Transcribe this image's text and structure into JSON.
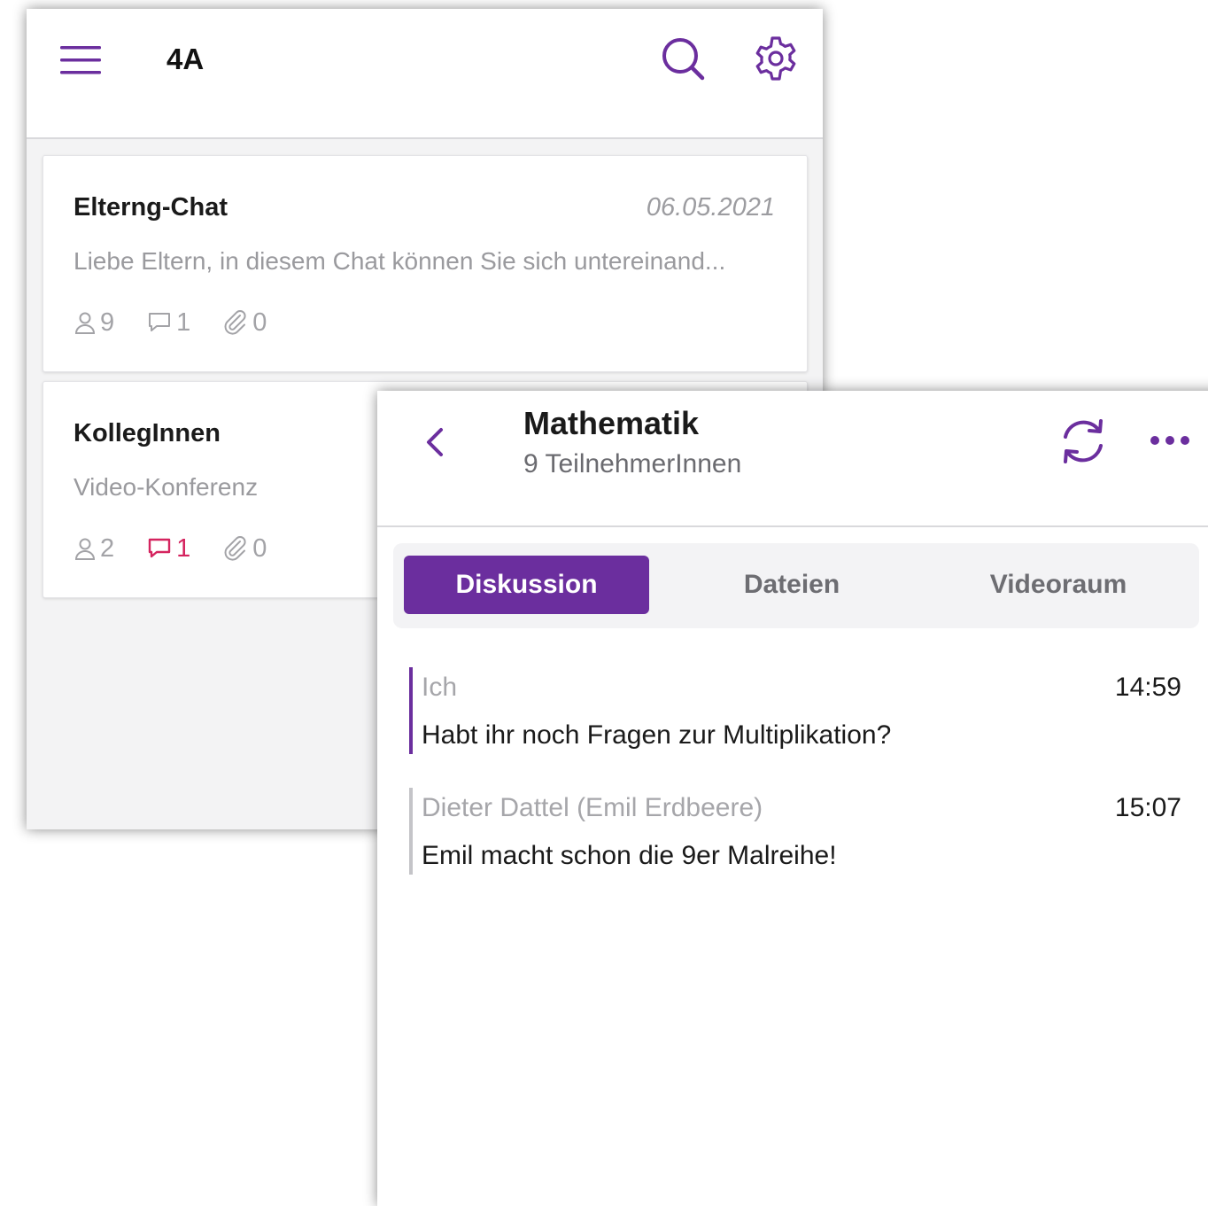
{
  "colors": {
    "accent": "#6b2e9e",
    "unread": "#d5245f",
    "muted": "#9a9a9e"
  },
  "group_list": {
    "header": {
      "title": "4A",
      "menu_icon": "hamburger-menu-icon",
      "search_icon": "search-icon",
      "settings_icon": "gear-icon"
    },
    "cards": [
      {
        "title": "Elterng-Chat",
        "date": "06.05.2021",
        "preview": "Liebe Eltern, in diesem Chat können Sie sich untereinand...",
        "members": "9",
        "comments": "1",
        "attachments": "0"
      },
      {
        "title": "KollegInnen",
        "date": "",
        "preview": "Video-Konferenz",
        "members": "2",
        "comments": "1",
        "attachments": "0"
      }
    ]
  },
  "chat": {
    "header": {
      "title": "Mathematik",
      "subtitle": "9 TeilnehmerInnen",
      "back_icon": "chevron-left-icon",
      "refresh_icon": "refresh-icon",
      "more_icon": "more-horizontal-icon"
    },
    "tabs": [
      {
        "label": "Diskussion",
        "active": true
      },
      {
        "label": "Dateien",
        "active": false
      },
      {
        "label": "Videoraum",
        "active": false
      }
    ],
    "messages": [
      {
        "author": "Ich",
        "time": "14:59",
        "text": "Habt ihr noch Fragen zur Multiplikation?"
      },
      {
        "author": "Dieter Dattel (Emil Erdbeere)",
        "time": "15:07",
        "text": "Emil macht schon die 9er Malreihe!"
      }
    ]
  }
}
